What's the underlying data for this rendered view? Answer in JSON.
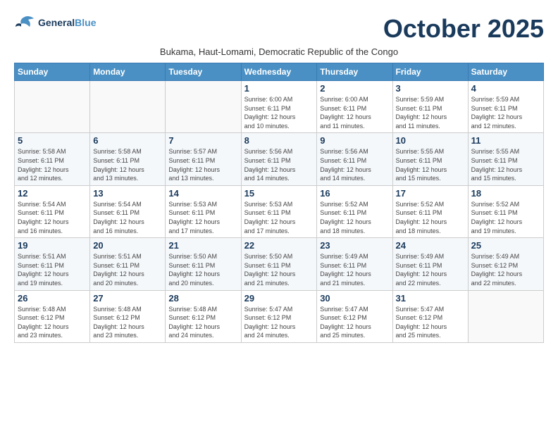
{
  "logo": {
    "line1": "General",
    "line2": "Blue"
  },
  "title": "October 2025",
  "subtitle": "Bukama, Haut-Lomami, Democratic Republic of the Congo",
  "weekdays": [
    "Sunday",
    "Monday",
    "Tuesday",
    "Wednesday",
    "Thursday",
    "Friday",
    "Saturday"
  ],
  "weeks": [
    [
      {
        "day": "",
        "info": ""
      },
      {
        "day": "",
        "info": ""
      },
      {
        "day": "",
        "info": ""
      },
      {
        "day": "1",
        "info": "Sunrise: 6:00 AM\nSunset: 6:11 PM\nDaylight: 12 hours\nand 10 minutes."
      },
      {
        "day": "2",
        "info": "Sunrise: 6:00 AM\nSunset: 6:11 PM\nDaylight: 12 hours\nand 11 minutes."
      },
      {
        "day": "3",
        "info": "Sunrise: 5:59 AM\nSunset: 6:11 PM\nDaylight: 12 hours\nand 11 minutes."
      },
      {
        "day": "4",
        "info": "Sunrise: 5:59 AM\nSunset: 6:11 PM\nDaylight: 12 hours\nand 12 minutes."
      }
    ],
    [
      {
        "day": "5",
        "info": "Sunrise: 5:58 AM\nSunset: 6:11 PM\nDaylight: 12 hours\nand 12 minutes."
      },
      {
        "day": "6",
        "info": "Sunrise: 5:58 AM\nSunset: 6:11 PM\nDaylight: 12 hours\nand 13 minutes."
      },
      {
        "day": "7",
        "info": "Sunrise: 5:57 AM\nSunset: 6:11 PM\nDaylight: 12 hours\nand 13 minutes."
      },
      {
        "day": "8",
        "info": "Sunrise: 5:56 AM\nSunset: 6:11 PM\nDaylight: 12 hours\nand 14 minutes."
      },
      {
        "day": "9",
        "info": "Sunrise: 5:56 AM\nSunset: 6:11 PM\nDaylight: 12 hours\nand 14 minutes."
      },
      {
        "day": "10",
        "info": "Sunrise: 5:55 AM\nSunset: 6:11 PM\nDaylight: 12 hours\nand 15 minutes."
      },
      {
        "day": "11",
        "info": "Sunrise: 5:55 AM\nSunset: 6:11 PM\nDaylight: 12 hours\nand 15 minutes."
      }
    ],
    [
      {
        "day": "12",
        "info": "Sunrise: 5:54 AM\nSunset: 6:11 PM\nDaylight: 12 hours\nand 16 minutes."
      },
      {
        "day": "13",
        "info": "Sunrise: 5:54 AM\nSunset: 6:11 PM\nDaylight: 12 hours\nand 16 minutes."
      },
      {
        "day": "14",
        "info": "Sunrise: 5:53 AM\nSunset: 6:11 PM\nDaylight: 12 hours\nand 17 minutes."
      },
      {
        "day": "15",
        "info": "Sunrise: 5:53 AM\nSunset: 6:11 PM\nDaylight: 12 hours\nand 17 minutes."
      },
      {
        "day": "16",
        "info": "Sunrise: 5:52 AM\nSunset: 6:11 PM\nDaylight: 12 hours\nand 18 minutes."
      },
      {
        "day": "17",
        "info": "Sunrise: 5:52 AM\nSunset: 6:11 PM\nDaylight: 12 hours\nand 18 minutes."
      },
      {
        "day": "18",
        "info": "Sunrise: 5:52 AM\nSunset: 6:11 PM\nDaylight: 12 hours\nand 19 minutes."
      }
    ],
    [
      {
        "day": "19",
        "info": "Sunrise: 5:51 AM\nSunset: 6:11 PM\nDaylight: 12 hours\nand 19 minutes."
      },
      {
        "day": "20",
        "info": "Sunrise: 5:51 AM\nSunset: 6:11 PM\nDaylight: 12 hours\nand 20 minutes."
      },
      {
        "day": "21",
        "info": "Sunrise: 5:50 AM\nSunset: 6:11 PM\nDaylight: 12 hours\nand 20 minutes."
      },
      {
        "day": "22",
        "info": "Sunrise: 5:50 AM\nSunset: 6:11 PM\nDaylight: 12 hours\nand 21 minutes."
      },
      {
        "day": "23",
        "info": "Sunrise: 5:49 AM\nSunset: 6:11 PM\nDaylight: 12 hours\nand 21 minutes."
      },
      {
        "day": "24",
        "info": "Sunrise: 5:49 AM\nSunset: 6:11 PM\nDaylight: 12 hours\nand 22 minutes."
      },
      {
        "day": "25",
        "info": "Sunrise: 5:49 AM\nSunset: 6:12 PM\nDaylight: 12 hours\nand 22 minutes."
      }
    ],
    [
      {
        "day": "26",
        "info": "Sunrise: 5:48 AM\nSunset: 6:12 PM\nDaylight: 12 hours\nand 23 minutes."
      },
      {
        "day": "27",
        "info": "Sunrise: 5:48 AM\nSunset: 6:12 PM\nDaylight: 12 hours\nand 23 minutes."
      },
      {
        "day": "28",
        "info": "Sunrise: 5:48 AM\nSunset: 6:12 PM\nDaylight: 12 hours\nand 24 minutes."
      },
      {
        "day": "29",
        "info": "Sunrise: 5:47 AM\nSunset: 6:12 PM\nDaylight: 12 hours\nand 24 minutes."
      },
      {
        "day": "30",
        "info": "Sunrise: 5:47 AM\nSunset: 6:12 PM\nDaylight: 12 hours\nand 25 minutes."
      },
      {
        "day": "31",
        "info": "Sunrise: 5:47 AM\nSunset: 6:12 PM\nDaylight: 12 hours\nand 25 minutes."
      },
      {
        "day": "",
        "info": ""
      }
    ]
  ]
}
